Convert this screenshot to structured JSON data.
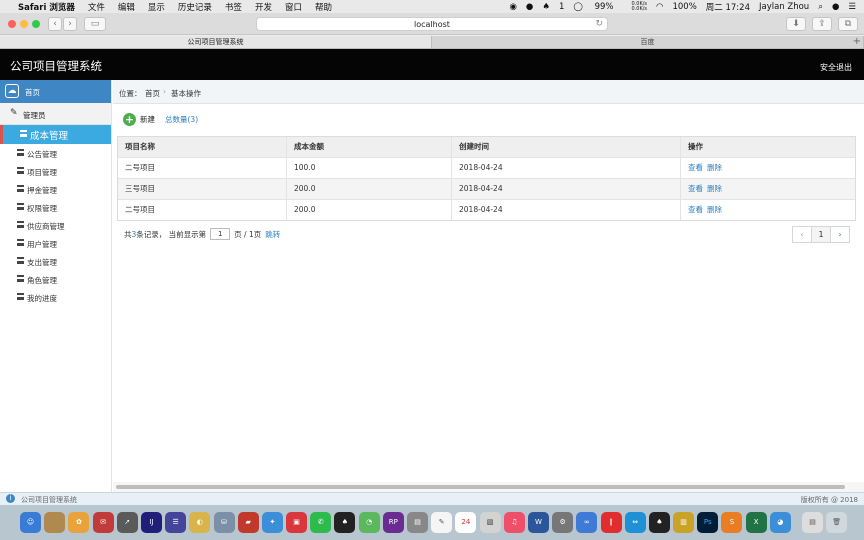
{
  "menubar": {
    "app_name": "Safari 浏览器",
    "menus": [
      "文件",
      "编辑",
      "显示",
      "历史记录",
      "书签",
      "开发",
      "窗口",
      "帮助"
    ],
    "status": {
      "notif_count": "1",
      "battery": "99%",
      "net_up": "0.0K/s",
      "net_down": "0.0K/s",
      "battery2": "100%",
      "clock": "周二 17:24",
      "user": "Jaylan Zhou"
    }
  },
  "browser": {
    "address": "localhost",
    "tabs": [
      {
        "label": "公司项目管理系统"
      },
      {
        "label": "百度"
      }
    ]
  },
  "header": {
    "title": "公司项目管理系统",
    "logout_label": "安全退出"
  },
  "sidebar": {
    "home_label": "首页",
    "admin_label": "管理员",
    "items": [
      {
        "label": "成本管理"
      },
      {
        "label": "公告管理"
      },
      {
        "label": "项目管理"
      },
      {
        "label": "押金管理"
      },
      {
        "label": "权限管理"
      },
      {
        "label": "供应商管理"
      },
      {
        "label": "用户管理"
      },
      {
        "label": "支出管理"
      },
      {
        "label": "角色管理"
      },
      {
        "label": "我的进度"
      }
    ]
  },
  "breadcrumb": {
    "prefix": "位置：",
    "home": "首页",
    "separator": "›",
    "current": "基本操作"
  },
  "actions": {
    "new_label": "新建",
    "count_label": "总数量(3)"
  },
  "table": {
    "columns": [
      "项目名称",
      "成本金额",
      "创建时间",
      "操作"
    ],
    "rows": [
      {
        "name": "二号项目",
        "amount": "100.0",
        "date": "2018-04-24",
        "view": "查看",
        "delete": "删除"
      },
      {
        "name": "三号项目",
        "amount": "200.0",
        "date": "2018-04-24",
        "view": "查看",
        "delete": "删除"
      },
      {
        "name": "二号项目",
        "amount": "200.0",
        "date": "2018-04-24",
        "view": "查看",
        "delete": "删除"
      }
    ]
  },
  "pager": {
    "text_a": "共",
    "total": "3",
    "text_b": "条记录，  当前显示第",
    "page_value": "1",
    "text_c": "页 / 1页",
    "jump_label": "跳转",
    "prev": "‹",
    "current": "1",
    "next": "›"
  },
  "statusbar": {
    "left": "公司项目管理系统",
    "right": "版权所有 @ 2018"
  },
  "colors": {
    "header_bg": "#050505",
    "accent": "#3aaae0",
    "home_bar": "#3e86c4",
    "link": "#2a7fc0",
    "add_green": "#4cae4c",
    "active_marker": "#d9534f"
  }
}
